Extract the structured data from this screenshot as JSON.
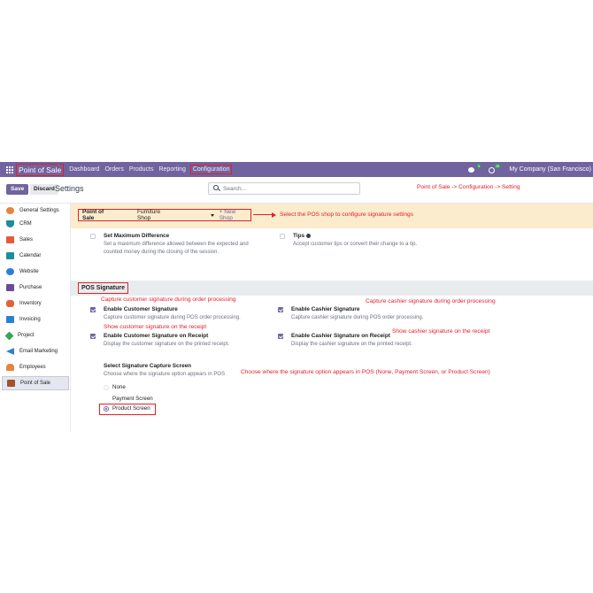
{
  "navbar": {
    "app_name": "Point of Sale",
    "menu": [
      "Dashboard",
      "Orders",
      "Products",
      "Reporting",
      "Configuration"
    ],
    "chat_badge": "9",
    "activity_badge": "28",
    "company": "My Company (San Francisco)"
  },
  "control_panel": {
    "save_label": "Save",
    "discard_label": "Discard",
    "title": "Settings",
    "search_placeholder": "Search..."
  },
  "sidebar": {
    "items": [
      {
        "label": "General Settings",
        "icon": "gear-icon",
        "color": "#e8833a"
      },
      {
        "label": "CRM",
        "icon": "crm-icon",
        "color": "#1d8c9b"
      },
      {
        "label": "Sales",
        "icon": "sales-icon",
        "color": "#e35b3a"
      },
      {
        "label": "Calendar",
        "icon": "calendar-icon",
        "color": "#1d8c9b"
      },
      {
        "label": "Website",
        "icon": "website-icon",
        "color": "#2c80d3"
      },
      {
        "label": "Purchase",
        "icon": "purchase-icon",
        "color": "#6a4c93"
      },
      {
        "label": "Inventory",
        "icon": "inventory-icon",
        "color": "#e0633c"
      },
      {
        "label": "Invoicing",
        "icon": "invoicing-icon",
        "color": "#2c80d3"
      },
      {
        "label": "Project",
        "icon": "project-icon",
        "color": "#3aa35b"
      },
      {
        "label": "Email Marketing",
        "icon": "email-marketing-icon",
        "color": "#2c80d3"
      },
      {
        "label": "Employees",
        "icon": "employees-icon",
        "color": "#e8833a"
      },
      {
        "label": "Point of Sale",
        "icon": "pos-icon",
        "color": "#a0522d",
        "active": true
      }
    ]
  },
  "shop_bar": {
    "label": "Point of Sale",
    "value": "Furniture Shop",
    "new_shop": "+ New Shop"
  },
  "settings": {
    "max_diff_title": "Set Maximum Difference",
    "max_diff_desc1": "Set a maximum difference allowed between the expected and",
    "max_diff_desc2": "counted money during the closing of the session.",
    "tips_title": "Tips",
    "tips_desc": "Accept customer tips or convert their change to a tip.",
    "section_title": "POS Signature",
    "customer_sig_title": "Enable Customer Signature",
    "customer_sig_desc": "Capture customer signature during POS order processing.",
    "cashier_sig_title": "Enable Cashier Signature",
    "cashier_sig_desc": "Capture cashier signature during POS order processing.",
    "customer_receipt_title": "Enable Customer Signature on Receipt",
    "customer_receipt_desc": "Display the customer signature on the printed receipt.",
    "cashier_receipt_title": "Enable Cashier Signature on Receipt",
    "cashier_receipt_desc": "Display the cashier signature on the printed receipt.",
    "capture_screen_title": "Select Signature Capture Screen",
    "capture_screen_desc": "Choose where the signature option appears in POS",
    "options": [
      "None",
      "Payment Screen",
      "Product Screen"
    ],
    "selected_option": "Product Screen"
  },
  "annotations": {
    "nav_path": "Point of Sale -> Configuration -> Setting",
    "shop_select": "Select the POS shop to configure signature settings",
    "customer_capture": "Capture customer signature during order processing",
    "cashier_capture": "Capture cashier signature during order processing",
    "customer_receipt": "Show customer signature on the receipt",
    "cashier_receipt": "Show cashier signature on the receipt",
    "capture_screen": "Choose where the signature option appears in POS (None, Payment Screen, or Product Screen)"
  },
  "colors": {
    "brand": "#71639e",
    "annotation": "#e0202a",
    "shop_bar_bg": "#fbeccd"
  }
}
